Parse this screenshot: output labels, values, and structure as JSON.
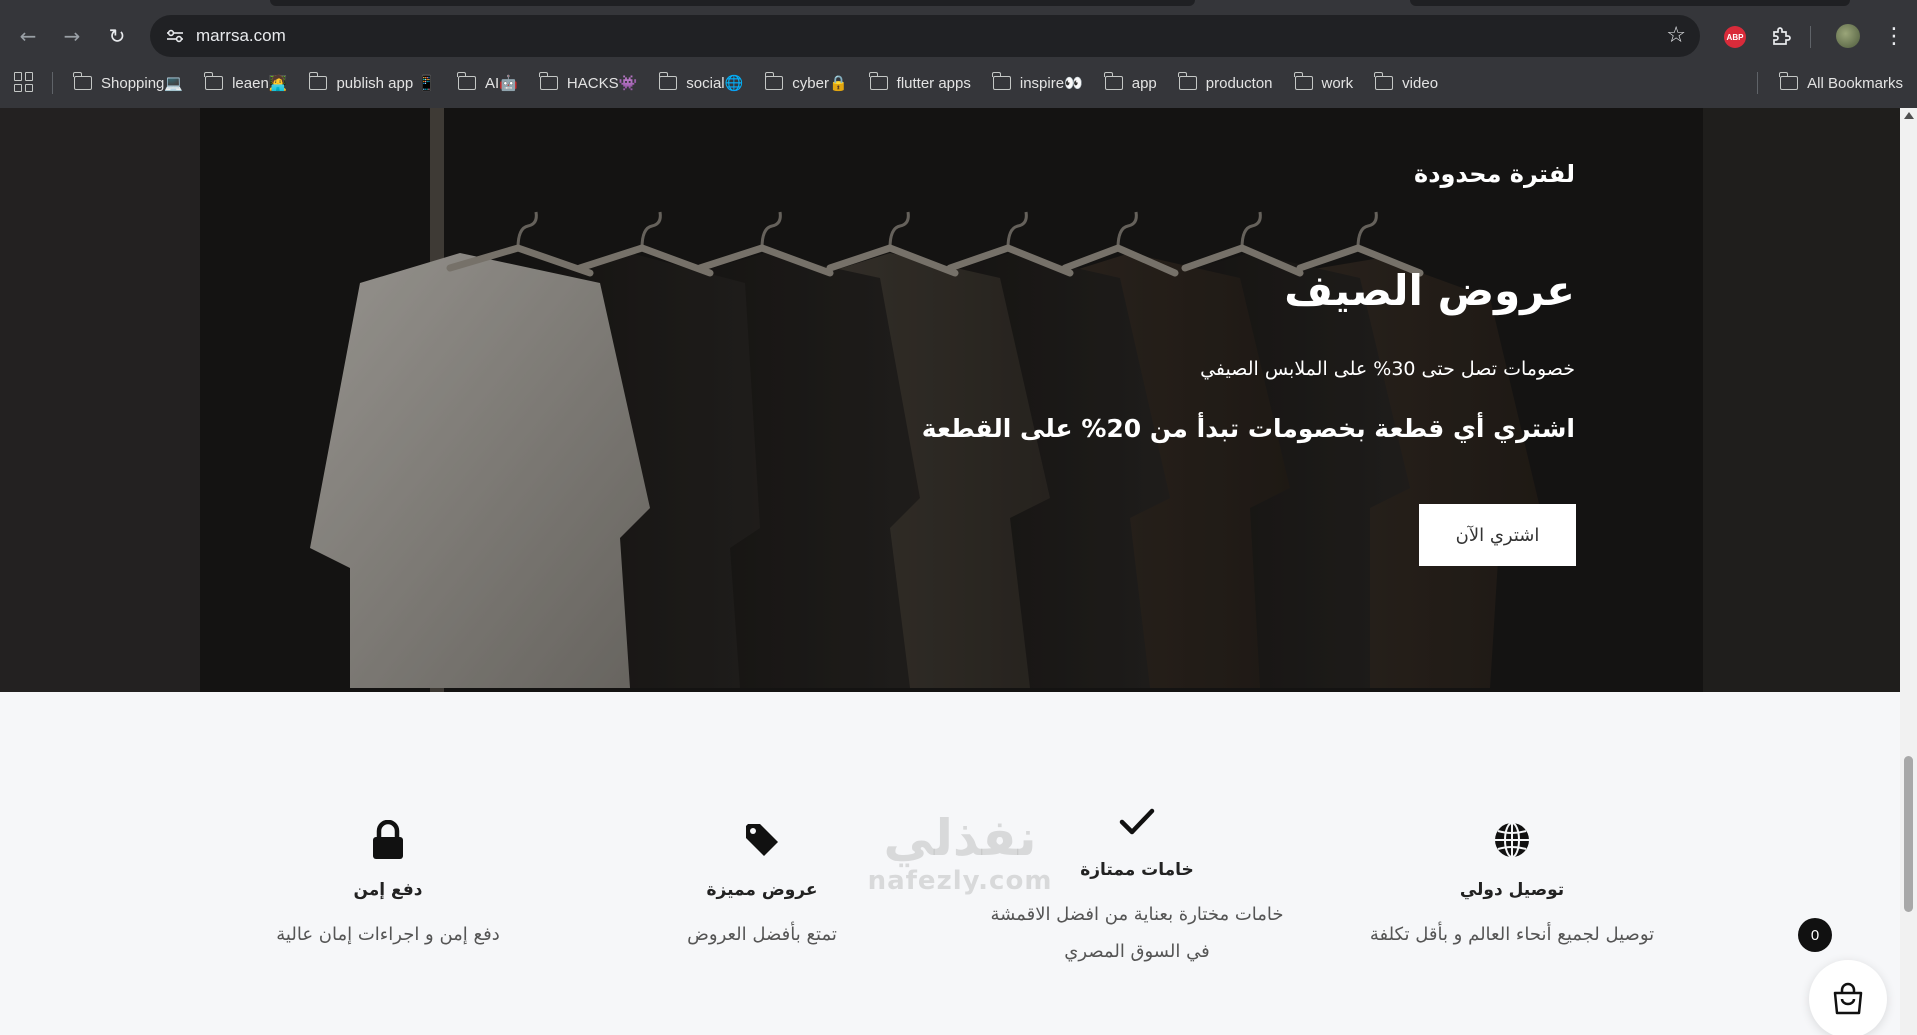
{
  "browser": {
    "url": "marrsa.com",
    "bookmarks": [
      {
        "label": "Shopping💻"
      },
      {
        "label": "leaen🧑‍💻"
      },
      {
        "label": "publish app 📱"
      },
      {
        "label": "AI🤖"
      },
      {
        "label": "HACKS👾"
      },
      {
        "label": "social🌐"
      },
      {
        "label": "cyber🔒"
      },
      {
        "label": "flutter apps"
      },
      {
        "label": "inspire👀"
      },
      {
        "label": "app"
      },
      {
        "label": "producton"
      },
      {
        "label": "work"
      },
      {
        "label": "video"
      }
    ],
    "all_bookmarks": "All Bookmarks",
    "extension_abp": "ABP"
  },
  "hero": {
    "eyebrow": "لفترة محدودة",
    "title": "عروض الصيف",
    "subtitle": "خصومات تصل حتى 30% على الملابس الصيفي",
    "lead": "اشتري أي قطعة بخصومات تبدأ من 20% على القطعة",
    "cta_label": "اشتري الآن"
  },
  "features": [
    {
      "icon": "lock-icon",
      "title": "دفع إمن",
      "desc_lines": [
        "دفع إمن و اجراءات إمان عالية"
      ]
    },
    {
      "icon": "tag-icon",
      "title": "عروض مميزة",
      "desc_lines": [
        "تمتع بأفضل العروض"
      ]
    },
    {
      "icon": "check-icon",
      "title": "خامات ممتازة",
      "desc_lines": [
        "خامات مختارة بعناية من افضل الاقمشة",
        "في السوق المصري"
      ]
    },
    {
      "icon": "globe-icon",
      "title": "توصيل دولي",
      "desc_lines": [
        "توصيل لجميع أنحاء العالم و بأقل تكلفة"
      ]
    }
  ],
  "watermark": {
    "arabic": "نفذلي",
    "latin": "nafezly.com"
  },
  "cart": {
    "count": "0"
  }
}
